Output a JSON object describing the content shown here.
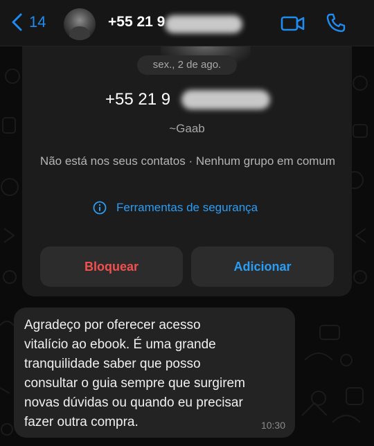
{
  "header": {
    "back_count": "14",
    "contact_name": "+55 21 9",
    "icons": [
      "chevron-left-icon",
      "video-call-icon",
      "phone-icon"
    ]
  },
  "card": {
    "date": "sex., 2 de ago.",
    "phone": "+55 21 9",
    "nickname": "~Gaab",
    "status": "Não está nos seus contatos · Nenhum grupo em comum",
    "safety_tools": "Ferramentas de segurança",
    "block_label": "Bloquear",
    "add_label": "Adicionar"
  },
  "message": {
    "text": "Agradeço por oferecer acesso\nvitalício ao ebook. É uma grande\ntranquilidade saber que posso\nconsultar o guia sempre que surgirem\nnovas dúvidas ou quando eu precisar\nfazer outra compra.",
    "time": "10:30"
  },
  "colors": {
    "accent": "#1f8cf2",
    "danger": "#f2504f",
    "background": "#0b0b0b",
    "bubble": "#232323"
  }
}
